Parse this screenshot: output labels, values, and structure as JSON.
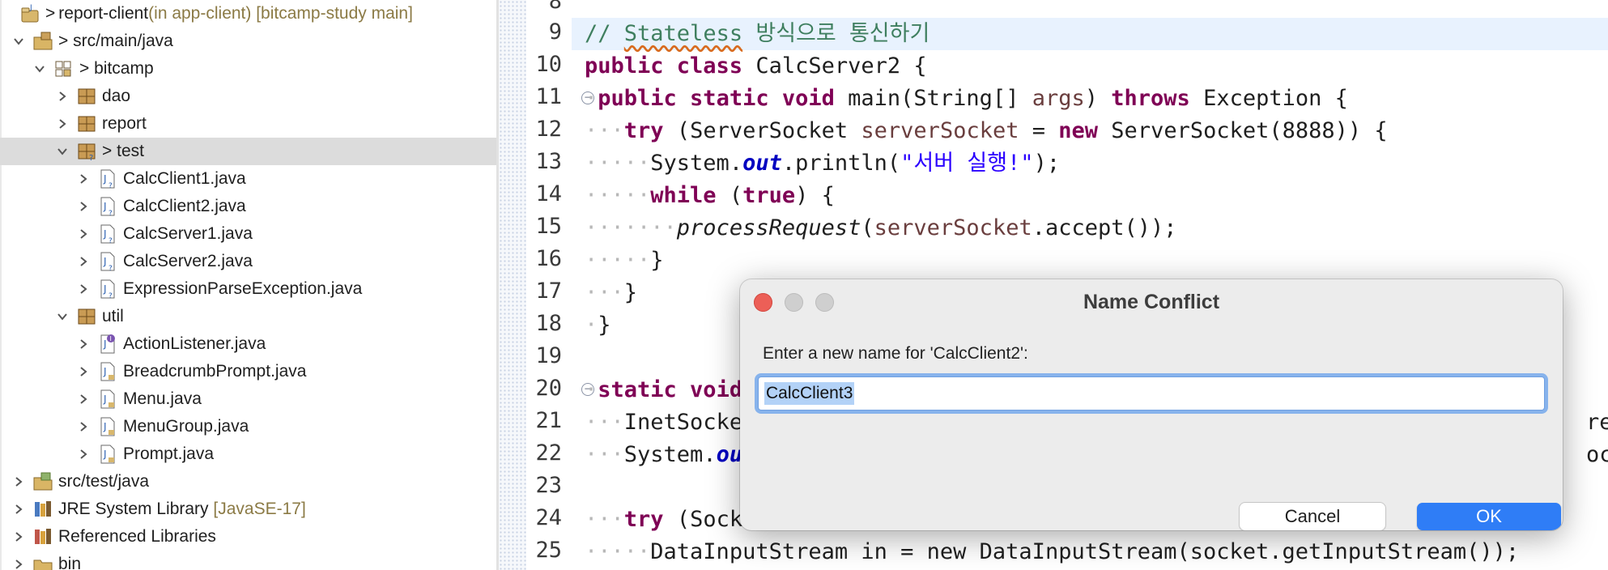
{
  "explorer": {
    "project": {
      "name": "report-client",
      "prefix": ">",
      "context": " (in app-client) [bitcamp-study main]"
    },
    "items": [
      {
        "label": "src/main/java",
        "prefix": "> "
      },
      {
        "label": "bitcamp",
        "prefix": "> "
      },
      {
        "label": "dao"
      },
      {
        "label": "report"
      },
      {
        "label": "test",
        "prefix": "> "
      },
      {
        "label": "CalcClient1.java"
      },
      {
        "label": "CalcClient2.java"
      },
      {
        "label": "CalcServer1.java"
      },
      {
        "label": "CalcServer2.java"
      },
      {
        "label": "ExpressionParseException.java"
      },
      {
        "label": "util"
      },
      {
        "label": "ActionListener.java"
      },
      {
        "label": "BreadcrumbPrompt.java"
      },
      {
        "label": "Menu.java"
      },
      {
        "label": "MenuGroup.java"
      },
      {
        "label": "Prompt.java"
      },
      {
        "label": "src/test/java"
      },
      {
        "label": "JRE System Library",
        "suffix": " [JavaSE-17]"
      },
      {
        "label": "Referenced Libraries"
      },
      {
        "label": "bin"
      }
    ]
  },
  "editor": {
    "line_numbers": [
      "8",
      "9",
      "10",
      "11",
      "12",
      "13",
      "14",
      "15",
      "16",
      "17",
      "18",
      "19",
      "20",
      "21",
      "22",
      "23",
      "24",
      "25"
    ],
    "code": {
      "l9_comment": "// ",
      "l9_stateless": "Stateless",
      "l9_rest": " 방식으로 통신하기",
      "l10_a": "public class",
      "l10_b": " CalcServer2 {",
      "l11_kw": "public static void",
      "l11_b": " main(String[] ",
      "l11_args": "args",
      "l11_c": ") ",
      "l11_throws": "throws",
      "l11_d": " Exception {",
      "l12_try": "try",
      "l12_a": " (ServerSocket ",
      "l12_var": "serverSocket",
      "l12_b": " = ",
      "l12_new": "new",
      "l12_c": " ServerSocket(8888)) {",
      "l13_a": "System.",
      "l13_out": "out",
      "l13_b": ".println(",
      "l13_str": "\"서버 실행!\"",
      "l13_c": ");",
      "l14_while": "while",
      "l14_a": " (",
      "l14_true": "true",
      "l14_b": ") {",
      "l15_m": "processRequest",
      "l15_a": "(",
      "l15_var": "serverSocket",
      "l15_b": ".accept());",
      "l16": "}",
      "l17": "}",
      "l18": "}",
      "l20_kw": "static void",
      "l21": "InetSocke",
      "l21_tail": "re",
      "l22_a": "System.",
      "l22_out": "ou",
      "l22_tail": "oc",
      "l24_try": "try",
      "l24_a": " (Sock",
      "l25": "DataInputStream in = new DataInputStream(socket.getInputStream());"
    }
  },
  "dialog": {
    "title": "Name Conflict",
    "prompt": "Enter a new name for 'CalcClient2':",
    "input_value": "CalcClient3",
    "cancel_label": "Cancel",
    "ok_label": "OK"
  },
  "colors": {
    "accent": "#2f7df6",
    "close": "#ec5f57",
    "disabled_traffic": "#cfcfcf",
    "selection": "#dcdcdc"
  }
}
